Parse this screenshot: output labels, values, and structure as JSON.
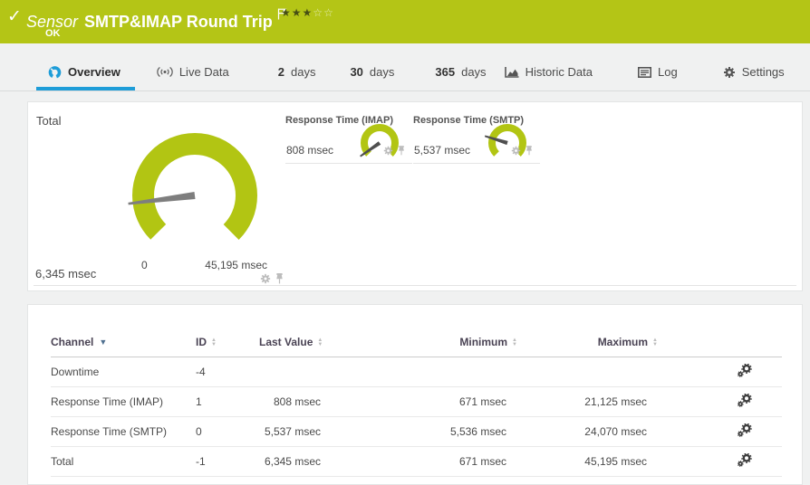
{
  "header": {
    "sensor_label": "Sensor",
    "title": "SMTP&IMAP Round Trip",
    "status": "OK",
    "rating_filled": 3,
    "rating_total": 5
  },
  "tabs": [
    {
      "prefix": "",
      "label": "Overview",
      "active": true
    },
    {
      "prefix": "",
      "label": "Live Data"
    },
    {
      "prefix": "2",
      "label": "days"
    },
    {
      "prefix": "30",
      "label": "days"
    },
    {
      "prefix": "365",
      "label": "days"
    },
    {
      "prefix": "",
      "label": "Historic Data"
    },
    {
      "prefix": "",
      "label": "Log"
    },
    {
      "prefix": "",
      "label": "Settings"
    }
  ],
  "gauges": {
    "total": {
      "label": "Total",
      "value_text": "6,345 msec",
      "min_label": "0",
      "max_label": "45,195 msec",
      "value": 6345,
      "min": 0,
      "max": 45195
    },
    "imap": {
      "label": "Response Time (IMAP)",
      "value_text": "808 msec",
      "value": 808,
      "min": 0,
      "max": 21125
    },
    "smtp": {
      "label": "Response Time (SMTP)",
      "value_text": "5,537 msec",
      "value": 5537,
      "min": 0,
      "max": 24070
    }
  },
  "table": {
    "columns": [
      {
        "label": "Channel"
      },
      {
        "label": "ID"
      },
      {
        "label": "Last Value"
      },
      {
        "label": "Minimum"
      },
      {
        "label": "Maximum"
      }
    ],
    "rows": [
      {
        "channel": "Downtime",
        "id": "-4",
        "last": "",
        "min": "",
        "max": ""
      },
      {
        "channel": "Response Time (IMAP)",
        "id": "1",
        "last": "808 msec",
        "min": "671 msec",
        "max": "21,125 msec"
      },
      {
        "channel": "Response Time (SMTP)",
        "id": "0",
        "last": "5,537 msec",
        "min": "5,536 msec",
        "max": "24,070 msec"
      },
      {
        "channel": "Total",
        "id": "-1",
        "last": "6,345 msec",
        "min": "671 msec",
        "max": "45,195 msec"
      }
    ]
  },
  "colors": {
    "banner_green": "#b4c516",
    "gauge_green": "#b2c513",
    "active_blue": "#1e9dd8"
  }
}
